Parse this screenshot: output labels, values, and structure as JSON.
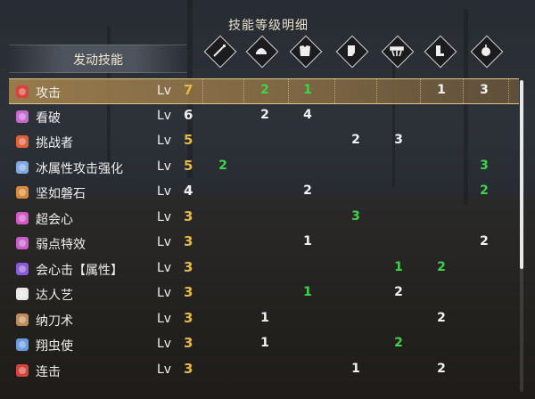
{
  "title": "技能等级明细",
  "header": {
    "label": "发动技能"
  },
  "slots": [
    {
      "icon": "weapon-slot-icon"
    },
    {
      "icon": "helm-slot-icon"
    },
    {
      "icon": "chest-slot-icon"
    },
    {
      "icon": "arm-slot-icon"
    },
    {
      "icon": "waist-slot-icon"
    },
    {
      "icon": "leg-slot-icon"
    },
    {
      "icon": "talisman-slot-icon"
    }
  ],
  "lv_label": "Lv",
  "skills": [
    {
      "name": "攻击",
      "lv": "7",
      "max": true,
      "color": "#d6453b",
      "cells": [
        {
          "v": "",
          "c": "white"
        },
        {
          "v": "2",
          "c": "green"
        },
        {
          "v": "1",
          "c": "green"
        },
        {
          "v": "",
          "c": "white"
        },
        {
          "v": "",
          "c": "white"
        },
        {
          "v": "1",
          "c": "white"
        },
        {
          "v": "3",
          "c": "white"
        }
      ]
    },
    {
      "name": "看破",
      "lv": "6",
      "max": false,
      "color": "#c66ad0",
      "cells": [
        {
          "v": "",
          "c": "white"
        },
        {
          "v": "2",
          "c": "white"
        },
        {
          "v": "4",
          "c": "white"
        },
        {
          "v": "",
          "c": "white"
        },
        {
          "v": "",
          "c": "white"
        },
        {
          "v": "",
          "c": "white"
        },
        {
          "v": "",
          "c": "white"
        }
      ]
    },
    {
      "name": "挑战者",
      "lv": "5",
      "max": true,
      "color": "#e0603a",
      "cells": [
        {
          "v": "",
          "c": "white"
        },
        {
          "v": "",
          "c": "white"
        },
        {
          "v": "",
          "c": "white"
        },
        {
          "v": "2",
          "c": "white"
        },
        {
          "v": "3",
          "c": "white"
        },
        {
          "v": "",
          "c": "white"
        },
        {
          "v": "",
          "c": "white"
        }
      ]
    },
    {
      "name": "冰属性攻击强化",
      "lv": "5",
      "max": true,
      "color": "#7fa9e0",
      "cells": [
        {
          "v": "2",
          "c": "green"
        },
        {
          "v": "",
          "c": "white"
        },
        {
          "v": "",
          "c": "white"
        },
        {
          "v": "",
          "c": "white"
        },
        {
          "v": "",
          "c": "white"
        },
        {
          "v": "",
          "c": "white"
        },
        {
          "v": "3",
          "c": "green"
        }
      ]
    },
    {
      "name": "坚如磐石",
      "lv": "4",
      "max": false,
      "color": "#d88a3a",
      "cells": [
        {
          "v": "",
          "c": "white"
        },
        {
          "v": "",
          "c": "white"
        },
        {
          "v": "2",
          "c": "white"
        },
        {
          "v": "",
          "c": "white"
        },
        {
          "v": "",
          "c": "white"
        },
        {
          "v": "",
          "c": "white"
        },
        {
          "v": "2",
          "c": "green"
        }
      ]
    },
    {
      "name": "超会心",
      "lv": "3",
      "max": true,
      "color": "#d05ac8",
      "cells": [
        {
          "v": "",
          "c": "white"
        },
        {
          "v": "",
          "c": "white"
        },
        {
          "v": "",
          "c": "white"
        },
        {
          "v": "3",
          "c": "green"
        },
        {
          "v": "",
          "c": "white"
        },
        {
          "v": "",
          "c": "white"
        },
        {
          "v": "",
          "c": "white"
        }
      ]
    },
    {
      "name": "弱点特效",
      "lv": "3",
      "max": true,
      "color": "#c65fc9",
      "cells": [
        {
          "v": "",
          "c": "white"
        },
        {
          "v": "",
          "c": "white"
        },
        {
          "v": "1",
          "c": "white"
        },
        {
          "v": "",
          "c": "white"
        },
        {
          "v": "",
          "c": "white"
        },
        {
          "v": "",
          "c": "white"
        },
        {
          "v": "2",
          "c": "white"
        }
      ]
    },
    {
      "name": "会心击【属性】",
      "lv": "3",
      "max": true,
      "color": "#8a5ad8",
      "cells": [
        {
          "v": "",
          "c": "white"
        },
        {
          "v": "",
          "c": "white"
        },
        {
          "v": "",
          "c": "white"
        },
        {
          "v": "",
          "c": "white"
        },
        {
          "v": "1",
          "c": "green"
        },
        {
          "v": "2",
          "c": "green"
        },
        {
          "v": "",
          "c": "white"
        }
      ]
    },
    {
      "name": "达人艺",
      "lv": "3",
      "max": true,
      "color": "#e8e8e8",
      "cells": [
        {
          "v": "",
          "c": "white"
        },
        {
          "v": "",
          "c": "white"
        },
        {
          "v": "1",
          "c": "green"
        },
        {
          "v": "",
          "c": "white"
        },
        {
          "v": "2",
          "c": "white"
        },
        {
          "v": "",
          "c": "white"
        },
        {
          "v": "",
          "c": "white"
        }
      ]
    },
    {
      "name": "纳刀术",
      "lv": "3",
      "max": true,
      "color": "#c08a5a",
      "cells": [
        {
          "v": "",
          "c": "white"
        },
        {
          "v": "1",
          "c": "white"
        },
        {
          "v": "",
          "c": "white"
        },
        {
          "v": "",
          "c": "white"
        },
        {
          "v": "",
          "c": "white"
        },
        {
          "v": "2",
          "c": "white"
        },
        {
          "v": "",
          "c": "white"
        }
      ]
    },
    {
      "name": "翔虫使",
      "lv": "3",
      "max": true,
      "color": "#6a9ae0",
      "cells": [
        {
          "v": "",
          "c": "white"
        },
        {
          "v": "1",
          "c": "white"
        },
        {
          "v": "",
          "c": "white"
        },
        {
          "v": "",
          "c": "white"
        },
        {
          "v": "2",
          "c": "green"
        },
        {
          "v": "",
          "c": "white"
        },
        {
          "v": "",
          "c": "white"
        }
      ]
    },
    {
      "name": "连击",
      "lv": "3",
      "max": true,
      "color": "#d6453b",
      "cells": [
        {
          "v": "",
          "c": "white"
        },
        {
          "v": "",
          "c": "white"
        },
        {
          "v": "",
          "c": "white"
        },
        {
          "v": "1",
          "c": "white"
        },
        {
          "v": "",
          "c": "white"
        },
        {
          "v": "2",
          "c": "white"
        },
        {
          "v": "",
          "c": "white"
        }
      ]
    }
  ]
}
